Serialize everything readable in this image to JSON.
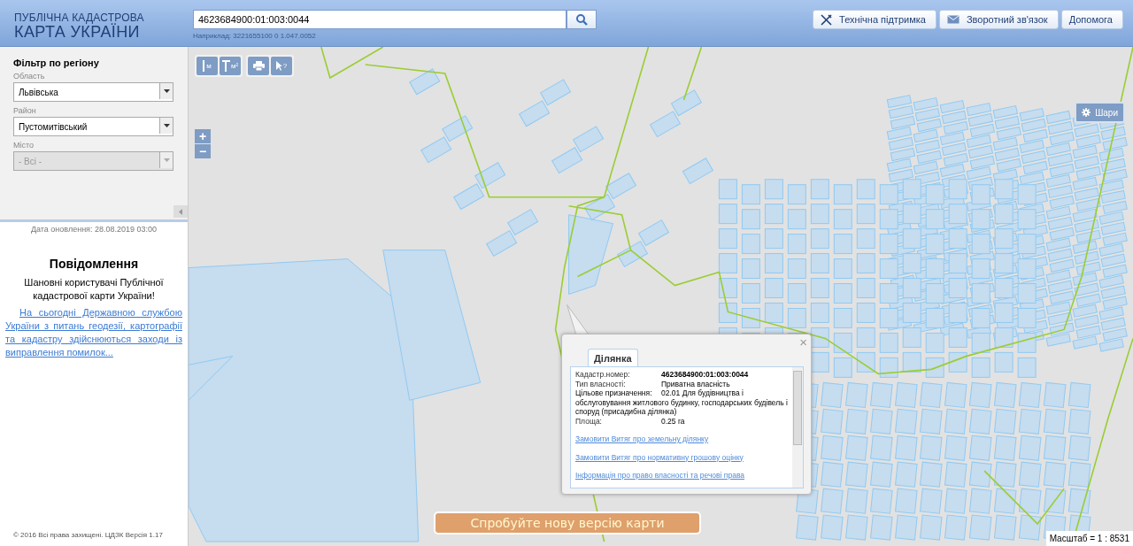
{
  "header": {
    "title_top": "ПУБЛІЧНА КАДАСТРОВА",
    "title_bottom": "КАРТА УКРАЇНИ",
    "search": {
      "value": "4623684900:01:003:0044"
    },
    "example": "Наприклад: 3221655100 0 1.047.0052",
    "buttons": [
      {
        "label": "Технічна підтримка",
        "kind": "tools"
      },
      {
        "label": "Зворотний зв'язок",
        "kind": "mail"
      },
      {
        "label": "Допомога",
        "kind": "plain"
      }
    ]
  },
  "sidebar": {
    "filter_title": "Фільтр по регіону",
    "fields": [
      {
        "label": "Область",
        "value": "Львівська",
        "disabled": false
      },
      {
        "label": "Район",
        "value": "Пустомитівський",
        "disabled": false
      },
      {
        "label": "Місто",
        "value": "- Всі -",
        "disabled": true
      }
    ],
    "update_date": "Дата оновлення: 28.08.2019 03:00",
    "notice": {
      "title": "Повідомлення",
      "text": "Шановні користувачі Публічної кадастрової карти України!",
      "link": "На сьогодні Державною службою України з питань геодезії, картографії та кадастру здійснюються заходи із виправлення помилок..."
    },
    "footer": "© 2016 Всі права захищені. ЦДЗК Версія 1.17"
  },
  "map": {
    "tools": [
      {
        "kind": "length",
        "label": "м"
      },
      {
        "kind": "area",
        "label": "м²"
      },
      {
        "kind": "print"
      },
      {
        "kind": "identify",
        "label": "?"
      }
    ],
    "zoom": [
      "+",
      "−"
    ],
    "layers_button": "Шари",
    "popup": {
      "close": "×",
      "tab": "Ділянка",
      "rows": [
        {
          "label": "Кадастр.номер:",
          "value": "4623684900:01:003:0044",
          "bold": true
        },
        {
          "label": "Тип власності:",
          "value": "Приватна власність",
          "bold": false
        },
        {
          "label": "Цільове призначення:",
          "value": "02.01 Для будівництва і обслуговування житлового будинку, господарських будівель і споруд (присадибна ділянка)",
          "bold": false
        },
        {
          "label": "Площа:",
          "value": "0.25 га",
          "bold": false
        }
      ],
      "links": [
        "Замовити Витяг про земельну ділянку",
        "Замовити Витяг про нормативну грошову оцінку",
        "Інформація про право власності та речові права"
      ]
    },
    "new_version_button": "Спробуйте нову версію карти",
    "scale": "Масштаб = 1 : 8531"
  }
}
